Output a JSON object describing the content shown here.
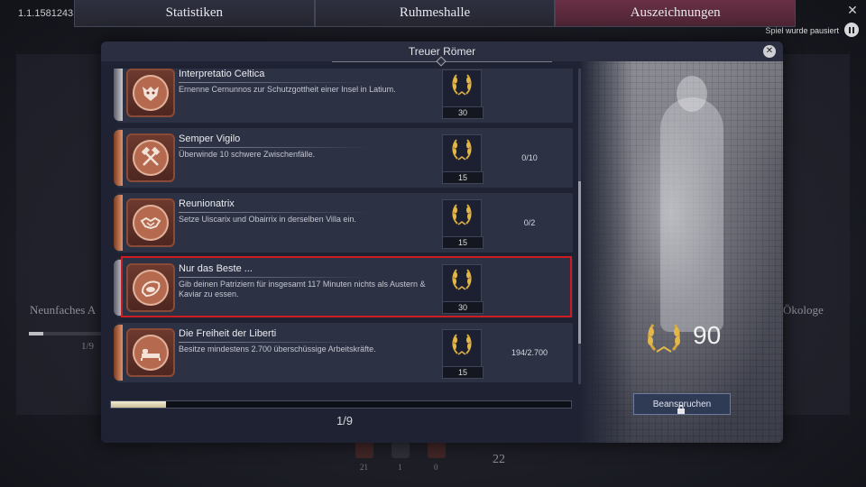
{
  "version": "1.1.1581243",
  "tabs": [
    {
      "label": "Statistiken",
      "active": false
    },
    {
      "label": "Ruhmeshalle",
      "active": false
    },
    {
      "label": "Auszeichnungen",
      "active": true
    }
  ],
  "pause_label": "Spiel wurde pausiert",
  "background": {
    "left_label": "Neunfaches A",
    "left_count": "1/9",
    "right_label": "Ökologe",
    "icon_counts": [
      "21",
      "1",
      "0"
    ],
    "center_count": "22"
  },
  "dialog": {
    "title": "Treuer Römer",
    "total_points": "90",
    "claim_label": "Beanspruchen",
    "page_indicator": "1/9",
    "list_progress": 0.12
  },
  "achievements": [
    {
      "title": "Interpretatio Celtica",
      "description": "Ernenne Cernunnos zur Schutzgottheit einer Insel in Latium.",
      "points": "30",
      "progress": "",
      "icon": "mask-icon",
      "tier": "grey"
    },
    {
      "title": "Semper Vigilo",
      "description": "Überwinde 10 schwere Zwischenfälle.",
      "points": "15",
      "progress": "0/10",
      "icon": "crossed-hammers-icon",
      "tier": "copper"
    },
    {
      "title": "Reunionatrix",
      "description": "Setze Uiscarix und Obairrix in derselben Villa ein.",
      "points": "15",
      "progress": "0/2",
      "icon": "handshake-icon",
      "tier": "copper"
    },
    {
      "title": "Nur das Beste ...",
      "description": "Gib deinen Patriziern für insgesamt 117 Minuten nichts als Austern & Kaviar zu essen.",
      "points": "30",
      "progress": "",
      "icon": "oyster-icon",
      "tier": "grey",
      "highlighted": true
    },
    {
      "title": "Die Freiheit der Liberti",
      "description": "Besitze mindestens 2.700 überschüssige Arbeitskräfte.",
      "points": "15",
      "progress": "194/2.700",
      "icon": "bed-icon",
      "tier": "copper"
    }
  ]
}
